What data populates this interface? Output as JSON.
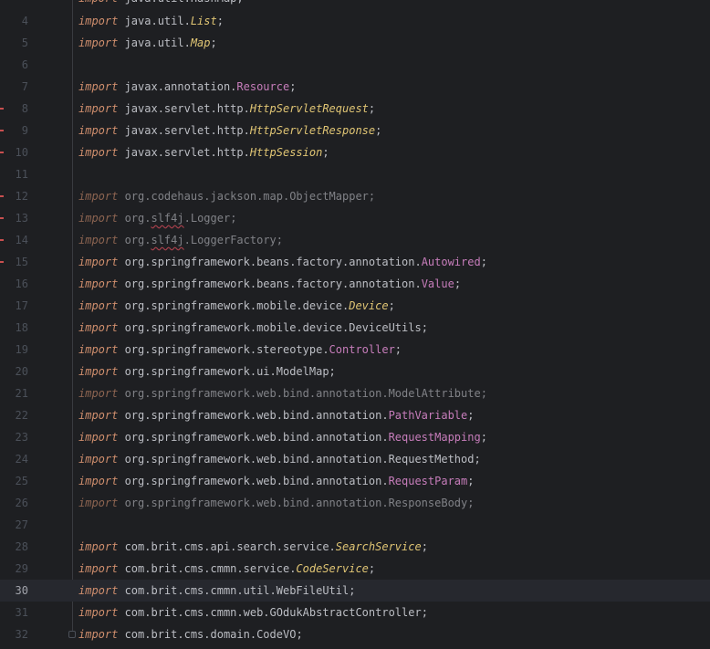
{
  "editor": {
    "current_line": "30",
    "lines": [
      {
        "n": "4",
        "kw": "import",
        "pkg": "java.util.",
        "name": "List",
        "kind": "intf",
        "end": ";"
      },
      {
        "n": "5",
        "kw": "import",
        "pkg": "java.util.",
        "name": "Map",
        "kind": "intf",
        "end": ";"
      },
      {
        "n": "6",
        "kw": "",
        "pkg": "",
        "name": "",
        "kind": "",
        "end": ""
      },
      {
        "n": "7",
        "kw": "import",
        "pkg": "javax.annotation.",
        "name": "Resource",
        "kind": "cls",
        "end": ";"
      },
      {
        "n": "8",
        "kw": "import",
        "pkg": "javax.servlet.http.",
        "name": "HttpServletRequest",
        "kind": "intf",
        "end": ";"
      },
      {
        "n": "9",
        "kw": "import",
        "pkg": "javax.servlet.http.",
        "name": "HttpServletResponse",
        "kind": "intf",
        "end": ";"
      },
      {
        "n": "10",
        "kw": "import",
        "pkg": "javax.servlet.http.",
        "name": "HttpSession",
        "kind": "intf",
        "end": ";"
      },
      {
        "n": "11",
        "kw": "",
        "pkg": "",
        "name": "",
        "kind": "",
        "end": ""
      },
      {
        "n": "12",
        "kw": "import",
        "pkg": "org.codehaus.jackson.map.",
        "name": "ObjectMapper",
        "kind": "dim",
        "end": ";"
      },
      {
        "n": "13",
        "kw": "import",
        "pkg": "org.",
        "pkg2": "slf4j",
        "pkg3": ".",
        "name": "Logger",
        "kind": "dim",
        "end": ";"
      },
      {
        "n": "14",
        "kw": "import",
        "pkg": "org.",
        "pkg2": "slf4j",
        "pkg3": ".",
        "name": "LoggerFactory",
        "kind": "dim",
        "end": ";"
      },
      {
        "n": "15",
        "kw": "import",
        "pkg": "org.springframework.beans.factory.annotation.",
        "name": "Autowired",
        "kind": "cls",
        "end": ";"
      },
      {
        "n": "16",
        "kw": "import",
        "pkg": "org.springframework.beans.factory.annotation.",
        "name": "Value",
        "kind": "cls",
        "end": ";"
      },
      {
        "n": "17",
        "kw": "import",
        "pkg": "org.springframework.mobile.device.",
        "name": "Device",
        "kind": "intf",
        "end": ";"
      },
      {
        "n": "18",
        "kw": "import",
        "pkg": "org.springframework.mobile.device.",
        "name": "DeviceUtils",
        "kind": "plain",
        "end": ";"
      },
      {
        "n": "19",
        "kw": "import",
        "pkg": "org.springframework.stereotype.",
        "name": "Controller",
        "kind": "cls",
        "end": ";"
      },
      {
        "n": "20",
        "kw": "import",
        "pkg": "org.springframework.ui.",
        "name": "ModelMap",
        "kind": "plain",
        "end": ";"
      },
      {
        "n": "21",
        "kw": "import",
        "pkg": "org.springframework.web.bind.annotation.",
        "name": "ModelAttribute",
        "kind": "dim",
        "end": ";"
      },
      {
        "n": "22",
        "kw": "import",
        "pkg": "org.springframework.web.bind.annotation.",
        "name": "PathVariable",
        "kind": "cls",
        "end": ";"
      },
      {
        "n": "23",
        "kw": "import",
        "pkg": "org.springframework.web.bind.annotation.",
        "name": "RequestMapping",
        "kind": "cls",
        "end": ";"
      },
      {
        "n": "24",
        "kw": "import",
        "pkg": "org.springframework.web.bind.annotation.",
        "name": "RequestMethod",
        "kind": "plain",
        "end": ";"
      },
      {
        "n": "25",
        "kw": "import",
        "pkg": "org.springframework.web.bind.annotation.",
        "name": "RequestParam",
        "kind": "cls",
        "end": ";"
      },
      {
        "n": "26",
        "kw": "import",
        "pkg": "org.springframework.web.bind.annotation.",
        "name": "ResponseBody",
        "kind": "dim",
        "end": ";"
      },
      {
        "n": "27",
        "kw": "",
        "pkg": "",
        "name": "",
        "kind": "",
        "end": ""
      },
      {
        "n": "28",
        "kw": "import",
        "pkg": "com.brit.cms.api.search.service.",
        "name": "SearchService",
        "kind": "intf",
        "end": ";"
      },
      {
        "n": "29",
        "kw": "import",
        "pkg": "com.brit.cms.cmmn.service.",
        "name": "CodeService",
        "kind": "intf",
        "end": ";"
      },
      {
        "n": "30",
        "kw": "import",
        "pkg": "com.brit.cms.cmmn.util.",
        "name": "WebFileUtil",
        "kind": "plain",
        "end": ";"
      },
      {
        "n": "31",
        "kw": "import",
        "pkg": "com.brit.cms.cmmn.web.",
        "name": "GOdukAbstractController",
        "kind": "plain",
        "end": ";"
      },
      {
        "n": "32",
        "kw": "import",
        "pkg": "com.brit.cms.domain.",
        "name": "CodeVO",
        "kind": "plain",
        "end": ";"
      }
    ],
    "top_partial": {
      "kw": "import",
      "pkg": "java.util.",
      "name": "HashMap",
      "end": ";"
    }
  },
  "colors": {
    "background": "#1e1f22",
    "keyword": "#cf8e6d",
    "class": "#c77dbb",
    "interface": "#e0c574",
    "text": "#bcbec4",
    "line_number": "#4b5059",
    "error_marker": "#c94f4f"
  }
}
